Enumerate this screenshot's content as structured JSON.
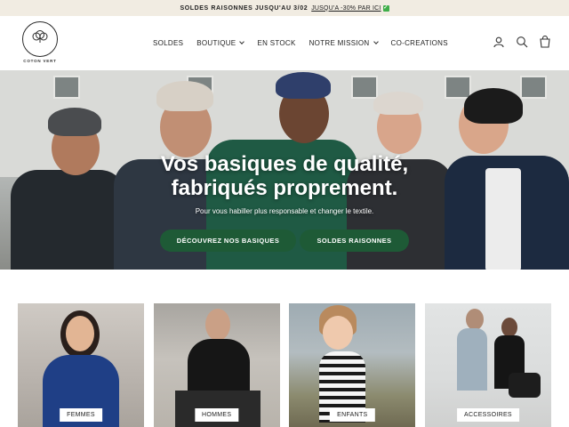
{
  "announcement": {
    "text": "SOLDES RAISONNES JUSQU'AU 3/02",
    "link": "JUSQU'A -30% PAR ICI",
    "check": "✓"
  },
  "logo": {
    "text": "COTON VERT"
  },
  "nav": {
    "items": [
      {
        "label": "SOLDES",
        "has_dropdown": false
      },
      {
        "label": "BOUTIQUE",
        "has_dropdown": true
      },
      {
        "label": "EN STOCK",
        "has_dropdown": false
      },
      {
        "label": "NOTRE MISSION",
        "has_dropdown": true
      },
      {
        "label": "CO-CREATIONS",
        "has_dropdown": false
      }
    ]
  },
  "header_icons": [
    "user-icon",
    "search-icon",
    "cart-icon"
  ],
  "hero": {
    "title_line1": "Vos basiques de qualité,",
    "title_line2": "fabriqués proprement.",
    "subtitle": "Pour vous habiller plus responsable et changer le textile.",
    "button_primary": "DÉCOUVREZ NOS BASIQUES",
    "button_secondary": "SOLDES RAISONNES"
  },
  "categories": [
    {
      "label": "FEMMES"
    },
    {
      "label": "HOMMES"
    },
    {
      "label": "ENFANTS"
    },
    {
      "label": "ACCESSOIRES"
    }
  ],
  "colors": {
    "accent": "#1e5a36",
    "announce_bg": "#f1ece2"
  }
}
